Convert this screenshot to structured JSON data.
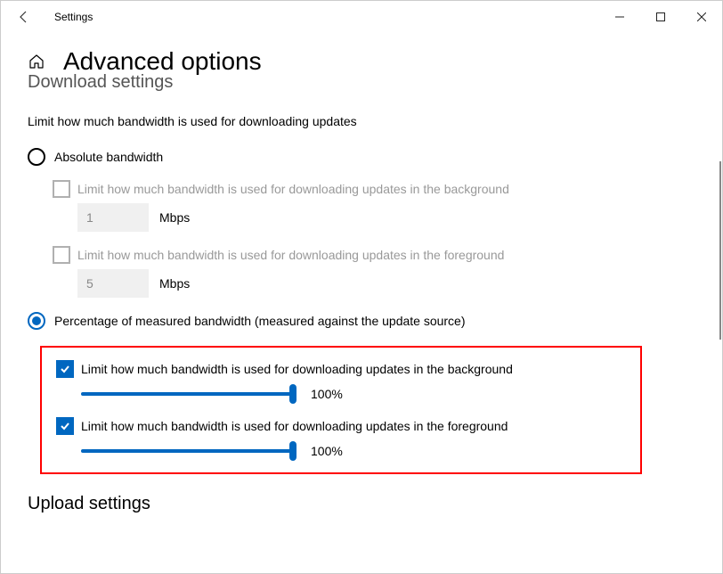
{
  "app": {
    "name": "Settings"
  },
  "header": {
    "title": "Advanced options"
  },
  "download_section": {
    "heading_partial": "Download settings",
    "description": "Limit how much bandwidth is used for downloading updates",
    "absolute": {
      "label": "Absolute bandwidth",
      "bg": {
        "check_label": "Limit how much bandwidth is used for downloading updates in the background",
        "value": "1",
        "unit": "Mbps"
      },
      "fg": {
        "check_label": "Limit how much bandwidth is used for downloading updates in the foreground",
        "value": "5",
        "unit": "Mbps"
      }
    },
    "percentage": {
      "label": "Percentage of measured bandwidth (measured against the update source)",
      "bg": {
        "check_label": "Limit how much bandwidth is used for downloading updates in the background",
        "value": "100%"
      },
      "fg": {
        "check_label": "Limit how much bandwidth is used for downloading updates in the foreground",
        "value": "100%"
      }
    }
  },
  "upload_section": {
    "heading": "Upload settings"
  }
}
